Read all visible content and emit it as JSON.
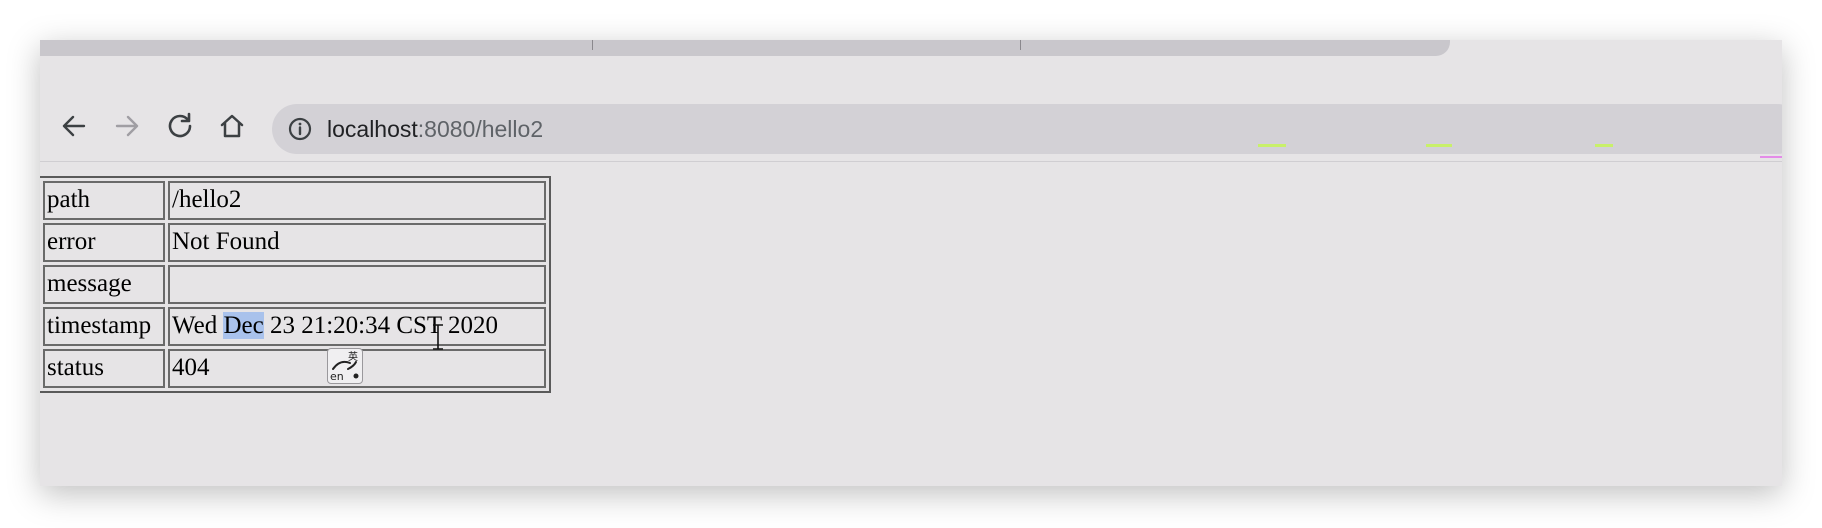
{
  "browser": {
    "address_bar": {
      "host": "localhost",
      "path": ":8080/hello2"
    },
    "nav": {
      "back": "back-arrow-icon",
      "forward": "forward-arrow-icon",
      "reload": "reload-icon",
      "home": "home-icon",
      "site_info": "info-icon"
    }
  },
  "error_table": {
    "rows": [
      {
        "key": "path",
        "value": "/hello2"
      },
      {
        "key": "error",
        "value": "Not Found"
      },
      {
        "key": "message",
        "value": ""
      },
      {
        "key": "timestamp",
        "value_before": "Wed ",
        "value_selected": "Dec",
        "value_after": " 23 21:20:34 CST 2020"
      },
      {
        "key": "status",
        "value": "404"
      }
    ]
  },
  "ime_indicator": {
    "top_glyph": "英",
    "bottom_text": "en"
  },
  "colors": {
    "page_bg": "#e6e4e6",
    "selection": "#a9c2ec",
    "omnibox": "#d3d1d6"
  }
}
